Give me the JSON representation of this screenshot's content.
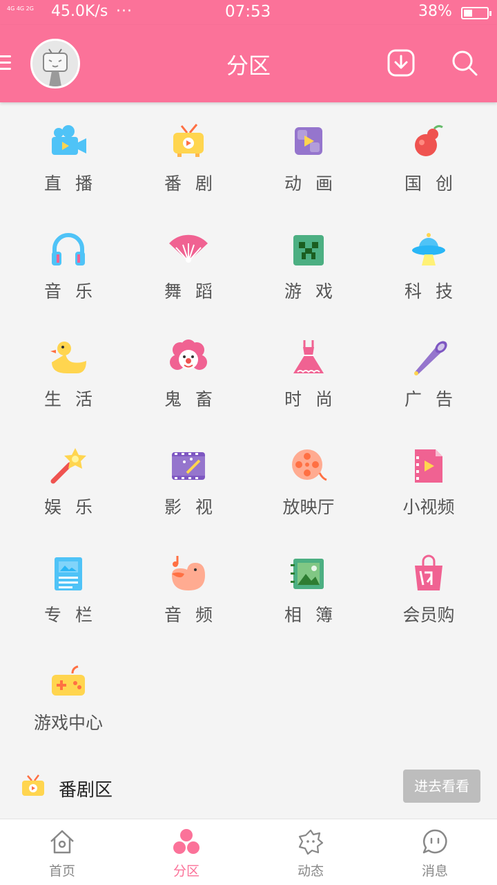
{
  "status_bar": {
    "network": "4G 4G 2G",
    "speed": "45.0K/s",
    "more": "···",
    "time": "07:53",
    "battery": "38%"
  },
  "header": {
    "title": "分区"
  },
  "categories": [
    {
      "label": "直 播",
      "icon": "live-camera-icon"
    },
    {
      "label": "番 剧",
      "icon": "tv-icon"
    },
    {
      "label": "动 画",
      "icon": "animation-icon"
    },
    {
      "label": "国 创",
      "icon": "gourd-icon"
    },
    {
      "label": "音 乐",
      "icon": "headphones-icon"
    },
    {
      "label": "舞 蹈",
      "icon": "fan-icon"
    },
    {
      "label": "游 戏",
      "icon": "creeper-icon"
    },
    {
      "label": "科 技",
      "icon": "ufo-icon"
    },
    {
      "label": "生 活",
      "icon": "duck-icon"
    },
    {
      "label": "鬼 畜",
      "icon": "clown-icon"
    },
    {
      "label": "时 尚",
      "icon": "dress-icon"
    },
    {
      "label": "广 告",
      "icon": "megaphone-icon"
    },
    {
      "label": "娱 乐",
      "icon": "magic-wand-icon"
    },
    {
      "label": "影 视",
      "icon": "film-icon"
    },
    {
      "label": "放映厅",
      "icon": "film-reel-icon"
    },
    {
      "label": "小视频",
      "icon": "video-file-icon"
    },
    {
      "label": "专 栏",
      "icon": "article-icon"
    },
    {
      "label": "音 频",
      "icon": "bird-music-icon"
    },
    {
      "label": "相 簿",
      "icon": "photo-album-icon"
    },
    {
      "label": "会员购",
      "icon": "shopping-bag-icon"
    },
    {
      "label": "游戏中心",
      "icon": "gamepad-icon"
    }
  ],
  "section": {
    "title": "番剧区",
    "more_button": "进去看看"
  },
  "tabs": [
    {
      "label": "首页",
      "icon": "home-icon"
    },
    {
      "label": "分区",
      "icon": "category-icon"
    },
    {
      "label": "动态",
      "icon": "dynamic-icon"
    },
    {
      "label": "消息",
      "icon": "message-icon"
    }
  ],
  "colors": {
    "primary": "#fb7299",
    "background": "#f4f4f4",
    "label": "#555555",
    "tab_inactive": "#888888"
  }
}
